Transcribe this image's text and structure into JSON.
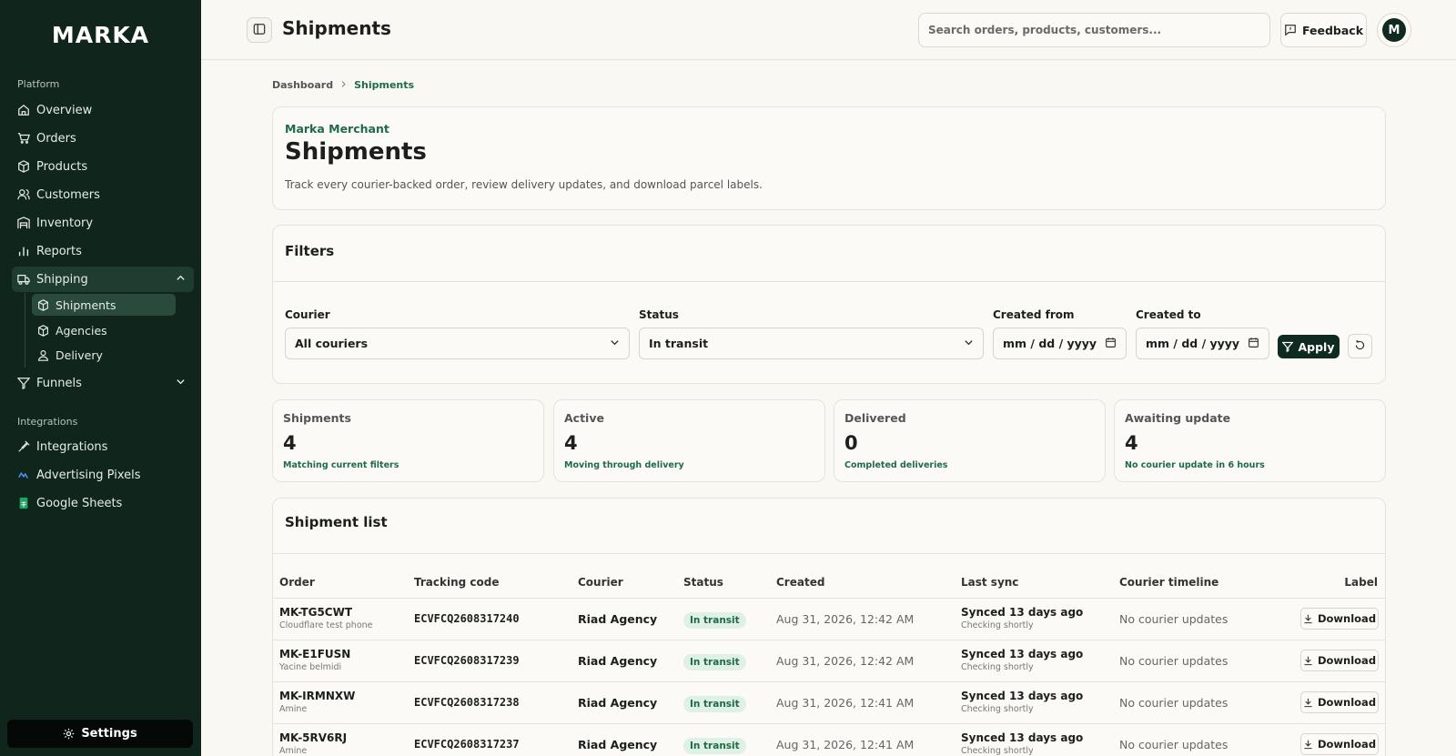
{
  "app": {
    "logo": "MARKA"
  },
  "sidebar": {
    "platform_label": "Platform",
    "integrations_label": "Integrations",
    "items": [
      {
        "label": "Overview",
        "icon": "home-icon"
      },
      {
        "label": "Orders",
        "icon": "cart-icon"
      },
      {
        "label": "Products",
        "icon": "box-icon"
      },
      {
        "label": "Customers",
        "icon": "users-icon"
      },
      {
        "label": "Inventory",
        "icon": "warehouse-icon"
      },
      {
        "label": "Reports",
        "icon": "bar-chart-icon"
      },
      {
        "label": "Shipping",
        "icon": "truck-icon"
      },
      {
        "label": "Funnels",
        "icon": "funnel-icon"
      }
    ],
    "shipping_sub": [
      {
        "label": "Shipments",
        "icon": "package-icon"
      },
      {
        "label": "Agencies",
        "icon": "package-icon"
      },
      {
        "label": "Delivery",
        "icon": "user-icon"
      }
    ],
    "integrations": [
      {
        "label": "Integrations",
        "icon": "plug-icon"
      },
      {
        "label": "Advertising Pixels",
        "icon": "pixel-icon"
      },
      {
        "label": "Google Sheets",
        "icon": "sheets-icon"
      }
    ],
    "settings_label": "Settings"
  },
  "header": {
    "title": "Shipments",
    "search_placeholder": "Search orders, products, customers...",
    "feedback_label": "Feedback",
    "avatar_initial": "M"
  },
  "breadcrumb": {
    "parent": "Dashboard",
    "current": "Shipments"
  },
  "hero": {
    "merchant": "Marka Merchant",
    "title": "Shipments",
    "description": "Track every courier-backed order, review delivery updates, and download parcel labels."
  },
  "filters": {
    "title": "Filters",
    "courier_label": "Courier",
    "courier_value": "All couriers",
    "status_label": "Status",
    "status_value": "In transit",
    "created_from_label": "Created from",
    "created_from_value": "mm / dd / yyyy",
    "created_to_label": "Created to",
    "created_to_value": "mm / dd / yyyy",
    "apply_label": "Apply"
  },
  "stats": [
    {
      "label": "Shipments",
      "value": "4",
      "note": "Matching current filters"
    },
    {
      "label": "Active",
      "value": "4",
      "note": "Moving through delivery"
    },
    {
      "label": "Delivered",
      "value": "0",
      "note": "Completed deliveries"
    },
    {
      "label": "Awaiting update",
      "value": "4",
      "note": "No courier update in 6 hours"
    }
  ],
  "list": {
    "title": "Shipment list",
    "columns": [
      "Order",
      "Tracking code",
      "Courier",
      "Status",
      "Created",
      "Last sync",
      "Courier timeline",
      "Label"
    ],
    "download_label": "Download",
    "rows": [
      {
        "order": "MK-TG5CWT",
        "customer": "Cloudflare test phone",
        "tracking": "ECVFCQ2608317240",
        "courier": "Riad Agency",
        "status": "In transit",
        "created": "Aug 31, 2026, 12:42 AM",
        "sync": "Synced 13 days ago",
        "sync_sub": "Checking shortly",
        "timeline": "No courier updates"
      },
      {
        "order": "MK-E1FUSN",
        "customer": "Yacine belmidi",
        "tracking": "ECVFCQ2608317239",
        "courier": "Riad Agency",
        "status": "In transit",
        "created": "Aug 31, 2026, 12:42 AM",
        "sync": "Synced 13 days ago",
        "sync_sub": "Checking shortly",
        "timeline": "No courier updates"
      },
      {
        "order": "MK-IRMNXW",
        "customer": "Amine",
        "tracking": "ECVFCQ2608317238",
        "courier": "Riad Agency",
        "status": "In transit",
        "created": "Aug 31, 2026, 12:41 AM",
        "sync": "Synced 13 days ago",
        "sync_sub": "Checking shortly",
        "timeline": "No courier updates"
      },
      {
        "order": "MK-5RV6RJ",
        "customer": "Amine",
        "tracking": "ECVFCQ2608317237",
        "courier": "Riad Agency",
        "status": "In transit",
        "created": "Aug 31, 2026, 12:41 AM",
        "sync": "Synced 13 days ago",
        "sync_sub": "Checking shortly",
        "timeline": "No courier updates"
      }
    ]
  },
  "colors": {
    "sidebar_bg": "#10261d",
    "accent_green": "#1f6b48",
    "primary_dark": "#0f2a20",
    "badge_bg": "#dff0e4",
    "page_bg": "#faf8f3"
  }
}
